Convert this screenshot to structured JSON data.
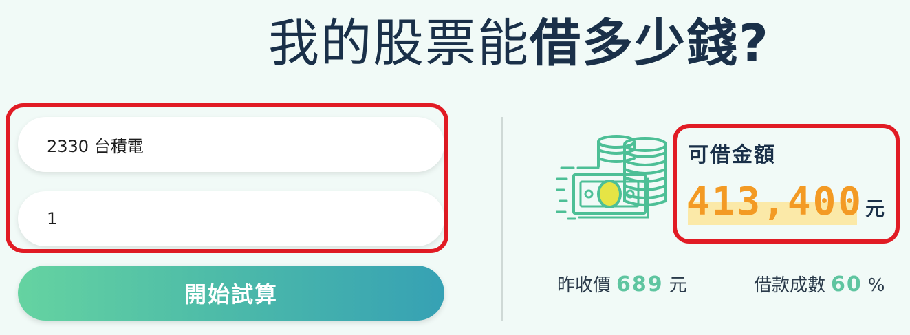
{
  "title": {
    "part1": "我的股票能",
    "part2": "借多少錢?"
  },
  "form": {
    "stock_value": "2330 台積電",
    "shares_value": "1",
    "submit_label": "開始試算"
  },
  "result": {
    "label": "可借金額",
    "amount": "413,400",
    "unit": "元",
    "icon": "money-coins-icon"
  },
  "stats": {
    "price_label": "昨收價",
    "price_value": "689",
    "price_unit": "元",
    "ratio_label": "借款成數",
    "ratio_value": "60",
    "ratio_unit": "%"
  },
  "colors": {
    "highlight_border": "#e11b24",
    "amount": "#f39a24",
    "accent_green": "#5fc5a0",
    "button_start": "#65d3a1",
    "button_end": "#36a1b4",
    "title": "#1a3049"
  }
}
